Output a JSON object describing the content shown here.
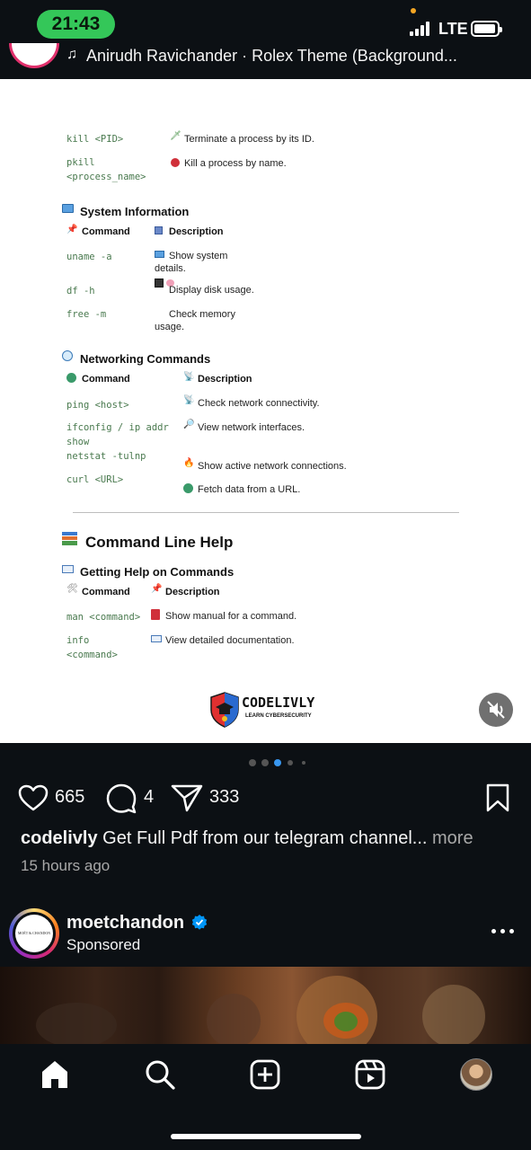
{
  "status_bar": {
    "time": "21:43",
    "network": "LTE"
  },
  "post_header": {
    "music_text": "Anirudh Ravichander · Rolex Theme (Background..."
  },
  "doc": {
    "process_rows": [
      {
        "command": "kill <PID>",
        "description": "Terminate a process by its ID."
      },
      {
        "command_lines": [
          "pkill",
          "<process_name>"
        ],
        "description": "Kill a process by name."
      }
    ],
    "system_info": {
      "title": "System Information",
      "col_command": "Command",
      "col_description": "Description",
      "rows": [
        {
          "command": "uname -a",
          "desc_lines": [
            "Show system",
            "details."
          ]
        },
        {
          "command": "df -h",
          "desc_lines": [
            "Display disk usage."
          ]
        },
        {
          "command": "free -m",
          "desc_lines": [
            "Check memory",
            "usage."
          ]
        }
      ]
    },
    "networking": {
      "title": "Networking Commands",
      "col_command": "Command",
      "col_description": "Description",
      "rows": [
        {
          "command_lines": [
            "ping <host>"
          ],
          "description": "Check network connectivity."
        },
        {
          "command_lines": [
            "ifconfig / ip addr",
            "show"
          ],
          "description": "View network interfaces."
        },
        {
          "command_lines": [
            "netstat -tulnp"
          ],
          "description": "Show active network connections."
        },
        {
          "command_lines": [
            "curl <URL>"
          ],
          "description": "Fetch data from a URL."
        }
      ]
    },
    "cli_help": {
      "title": "Command Line Help",
      "subtitle": "Getting Help on Commands",
      "col_command": "Command",
      "col_description": "Description",
      "rows": [
        {
          "command_lines": [
            "man <command>"
          ],
          "description": "Show manual for a command."
        },
        {
          "command_lines": [
            "info",
            "<command>"
          ],
          "description": "View detailed documentation."
        }
      ]
    },
    "logo": {
      "brand": "CODELIVLY",
      "tagline": "LEARN CYBERSECURITY"
    }
  },
  "carousel": {
    "dot_count": 5,
    "active_index": 2
  },
  "actions": {
    "likes": "665",
    "comments": "4",
    "shares": "333"
  },
  "caption": {
    "username": "codelivly",
    "text": "Get Full Pdf from our telegram channel...",
    "more": "more"
  },
  "time_ago": "15 hours ago",
  "sponsored": {
    "avatar_text": "MOËT & CHANDON",
    "username": "moetchandon",
    "label": "Sponsored"
  },
  "colors": {
    "accent_green": "#34c759",
    "verified_blue": "#0095f6",
    "background": "#0c1014"
  },
  "icons": [
    "heart-icon",
    "comment-icon",
    "share-icon",
    "bookmark-icon",
    "home-icon",
    "search-icon",
    "create-icon",
    "reels-icon",
    "profile-avatar"
  ]
}
